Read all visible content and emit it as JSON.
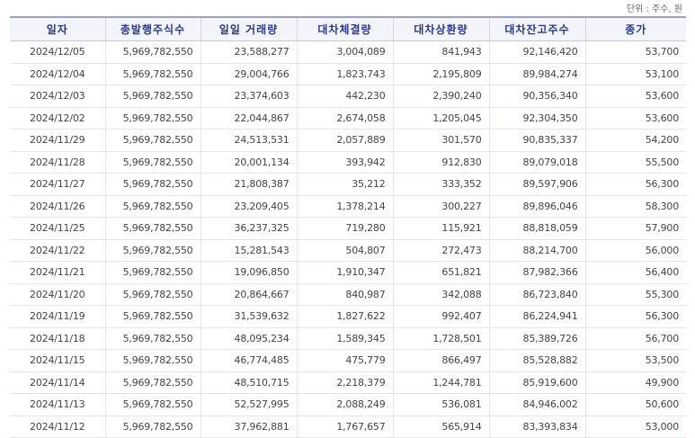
{
  "unit_label": "단위 : 주수, 원",
  "table": {
    "headers": [
      "일자",
      "총발행주식수",
      "일일 거래량",
      "대차체결량",
      "대차상환량",
      "대차잔고주수",
      "종가"
    ],
    "rows": [
      [
        "2024/12/05",
        "5,969,782,550",
        "23,588,277",
        "3,004,089",
        "841,943",
        "92,146,420",
        "53,700"
      ],
      [
        "2024/12/04",
        "5,969,782,550",
        "29,004,766",
        "1,823,743",
        "2,195,809",
        "89,984,274",
        "53,100"
      ],
      [
        "2024/12/03",
        "5,969,782,550",
        "23,374,603",
        "442,230",
        "2,390,240",
        "90,356,340",
        "53,600"
      ],
      [
        "2024/12/02",
        "5,969,782,550",
        "22,044,867",
        "2,674,058",
        "1,205,045",
        "92,304,350",
        "53,600"
      ],
      [
        "2024/11/29",
        "5,969,782,550",
        "24,513,531",
        "2,057,889",
        "301,570",
        "90,835,337",
        "54,200"
      ],
      [
        "2024/11/28",
        "5,969,782,550",
        "20,001,134",
        "393,942",
        "912,830",
        "89,079,018",
        "55,500"
      ],
      [
        "2024/11/27",
        "5,969,782,550",
        "21,808,387",
        "35,212",
        "333,352",
        "89,597,906",
        "56,300"
      ],
      [
        "2024/11/26",
        "5,969,782,550",
        "23,209,405",
        "1,378,214",
        "300,227",
        "89,896,046",
        "58,300"
      ],
      [
        "2024/11/25",
        "5,969,782,550",
        "36,237,325",
        "719,280",
        "115,921",
        "88,818,059",
        "57,900"
      ],
      [
        "2024/11/22",
        "5,969,782,550",
        "15,281,543",
        "504,807",
        "272,473",
        "88,214,700",
        "56,000"
      ],
      [
        "2024/11/21",
        "5,969,782,550",
        "19,096,850",
        "1,910,347",
        "651,821",
        "87,982,366",
        "56,400"
      ],
      [
        "2024/11/20",
        "5,969,782,550",
        "20,864,667",
        "840,987",
        "342,088",
        "86,723,840",
        "55,300"
      ],
      [
        "2024/11/19",
        "5,969,782,550",
        "31,539,632",
        "1,827,622",
        "992,407",
        "86,224,941",
        "56,300"
      ],
      [
        "2024/11/18",
        "5,969,782,550",
        "48,095,234",
        "1,589,345",
        "1,728,501",
        "85,389,726",
        "56,700"
      ],
      [
        "2024/11/15",
        "5,969,782,550",
        "46,774,485",
        "475,779",
        "866,497",
        "85,528,882",
        "53,500"
      ],
      [
        "2024/11/14",
        "5,969,782,550",
        "48,510,715",
        "2,218,379",
        "1,244,781",
        "85,919,600",
        "49,900"
      ],
      [
        "2024/11/13",
        "5,969,782,550",
        "52,527,995",
        "2,088,249",
        "536,081",
        "84,946,002",
        "50,600"
      ],
      [
        "2024/11/12",
        "5,969,782,550",
        "37,962,881",
        "1,767,657",
        "565,914",
        "83,393,834",
        "53,000"
      ]
    ]
  }
}
